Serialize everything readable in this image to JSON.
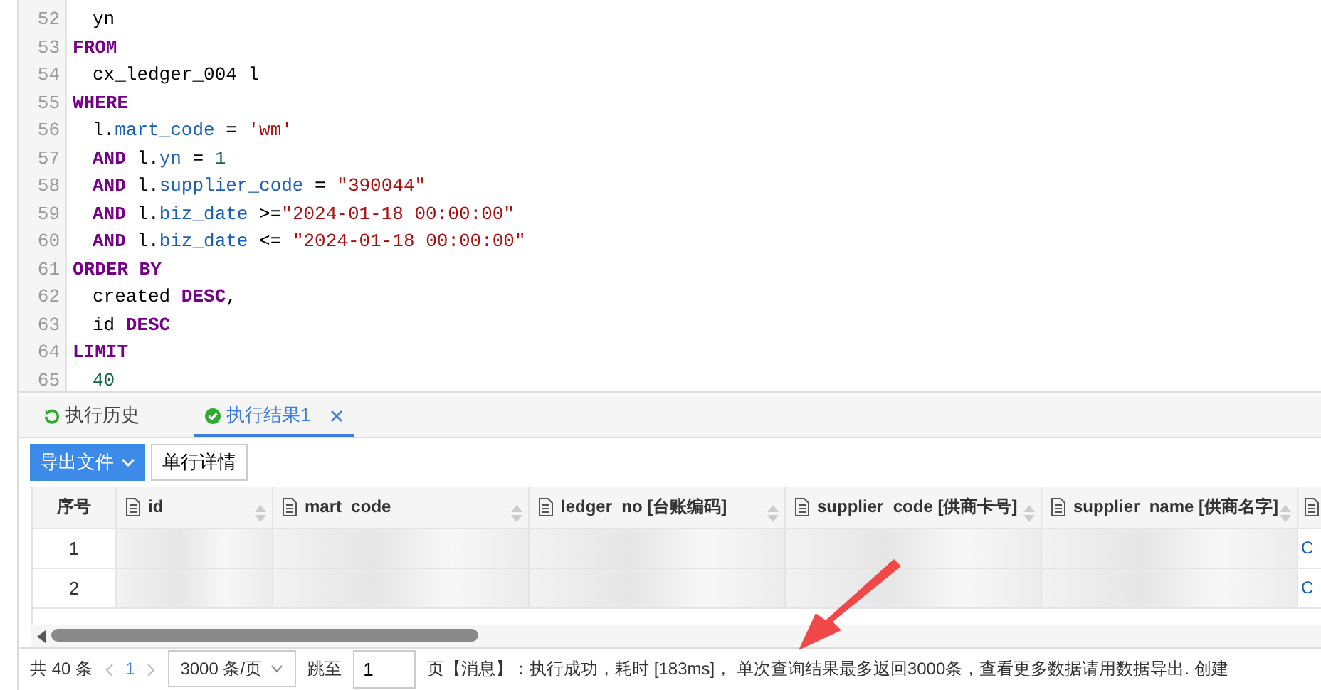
{
  "editor": {
    "lines": [
      {
        "number": "52",
        "indent": true,
        "tokens": [
          {
            "kind": "plain",
            "text": "yn"
          }
        ]
      },
      {
        "number": "53",
        "indent": false,
        "tokens": [
          {
            "kind": "keyword",
            "text": "FROM"
          }
        ]
      },
      {
        "number": "54",
        "indent": true,
        "tokens": [
          {
            "kind": "plain",
            "text": "cx_ledger_004 l"
          }
        ]
      },
      {
        "number": "55",
        "indent": false,
        "tokens": [
          {
            "kind": "keyword",
            "text": "WHERE"
          }
        ]
      },
      {
        "number": "56",
        "indent": true,
        "tokens": [
          {
            "kind": "plain",
            "text": "l."
          },
          {
            "kind": "field",
            "text": "mart_code"
          },
          {
            "kind": "plain",
            "text": " = "
          },
          {
            "kind": "string",
            "text": "'wm'"
          }
        ]
      },
      {
        "number": "57",
        "indent": true,
        "tokens": [
          {
            "kind": "keyword",
            "text": "AND"
          },
          {
            "kind": "plain",
            "text": " l."
          },
          {
            "kind": "field",
            "text": "yn"
          },
          {
            "kind": "plain",
            "text": " = "
          },
          {
            "kind": "number",
            "text": "1"
          }
        ]
      },
      {
        "number": "58",
        "indent": true,
        "tokens": [
          {
            "kind": "keyword",
            "text": "AND"
          },
          {
            "kind": "plain",
            "text": " l."
          },
          {
            "kind": "field",
            "text": "supplier_code"
          },
          {
            "kind": "plain",
            "text": " = "
          },
          {
            "kind": "string",
            "text": "\"390044\""
          }
        ]
      },
      {
        "number": "59",
        "indent": true,
        "tokens": [
          {
            "kind": "keyword",
            "text": "AND"
          },
          {
            "kind": "plain",
            "text": " l."
          },
          {
            "kind": "field",
            "text": "biz_date"
          },
          {
            "kind": "plain",
            "text": " >="
          },
          {
            "kind": "string",
            "text": "\"2024-01-18 00:00:00\""
          }
        ]
      },
      {
        "number": "60",
        "indent": true,
        "tokens": [
          {
            "kind": "keyword",
            "text": "AND"
          },
          {
            "kind": "plain",
            "text": " l."
          },
          {
            "kind": "field",
            "text": "biz_date"
          },
          {
            "kind": "plain",
            "text": " <= "
          },
          {
            "kind": "string",
            "text": "\"2024-01-18 00:00:00\""
          }
        ]
      },
      {
        "number": "61",
        "indent": false,
        "tokens": [
          {
            "kind": "keyword",
            "text": "ORDER BY"
          }
        ]
      },
      {
        "number": "62",
        "indent": true,
        "tokens": [
          {
            "kind": "plain",
            "text": "created "
          },
          {
            "kind": "keyword",
            "text": "DESC"
          },
          {
            "kind": "plain",
            "text": ","
          }
        ]
      },
      {
        "number": "63",
        "indent": true,
        "tokens": [
          {
            "kind": "plain",
            "text": "id "
          },
          {
            "kind": "keyword",
            "text": "DESC"
          }
        ]
      },
      {
        "number": "64",
        "indent": false,
        "tokens": [
          {
            "kind": "keyword",
            "text": "LIMIT"
          }
        ]
      },
      {
        "number": "65",
        "indent": true,
        "tokens": [
          {
            "kind": "number",
            "text": "40"
          }
        ]
      }
    ]
  },
  "tabs": [
    {
      "label": "执行历史",
      "kind": "history",
      "selected": false,
      "closable": false
    },
    {
      "label": "执行结果1",
      "kind": "result",
      "selected": true,
      "closable": true
    }
  ],
  "toolbar": {
    "export_button": "导出文件",
    "detail_button": "单行详情"
  },
  "table": {
    "columns": [
      {
        "label": "序号",
        "kind": "index"
      },
      {
        "label": "id",
        "kind": "field"
      },
      {
        "label": "mart_code",
        "kind": "field"
      },
      {
        "label": "ledger_no [台账编码]",
        "kind": "field"
      },
      {
        "label": "supplier_code [供商卡号]",
        "kind": "field"
      },
      {
        "label": "supplier_name [供商名字]",
        "kind": "field"
      },
      {
        "kind": "cut"
      }
    ],
    "rows": [
      {
        "index": "1",
        "last": "C"
      },
      {
        "index": "2",
        "last": "C"
      }
    ]
  },
  "footer": {
    "total": "共 40 条",
    "page": "1",
    "page_size": "3000 条/页",
    "jump_label": "跳至",
    "jump_value": "1",
    "page_suffix": "页",
    "message": "【消息】：执行成功，耗时 [183ms]， 单次查询结果最多返回3000条，查看更多数据请用数据导出. 创建"
  }
}
